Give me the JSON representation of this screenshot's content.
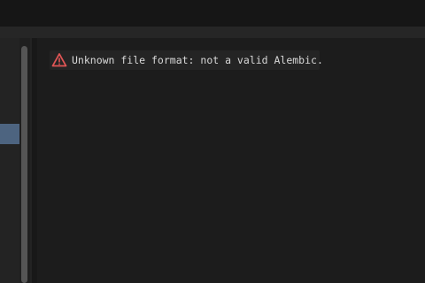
{
  "error": {
    "icon": "warning-triangle-icon",
    "message": "Unknown file format: not a valid Alembic.",
    "color": "#e05555"
  }
}
